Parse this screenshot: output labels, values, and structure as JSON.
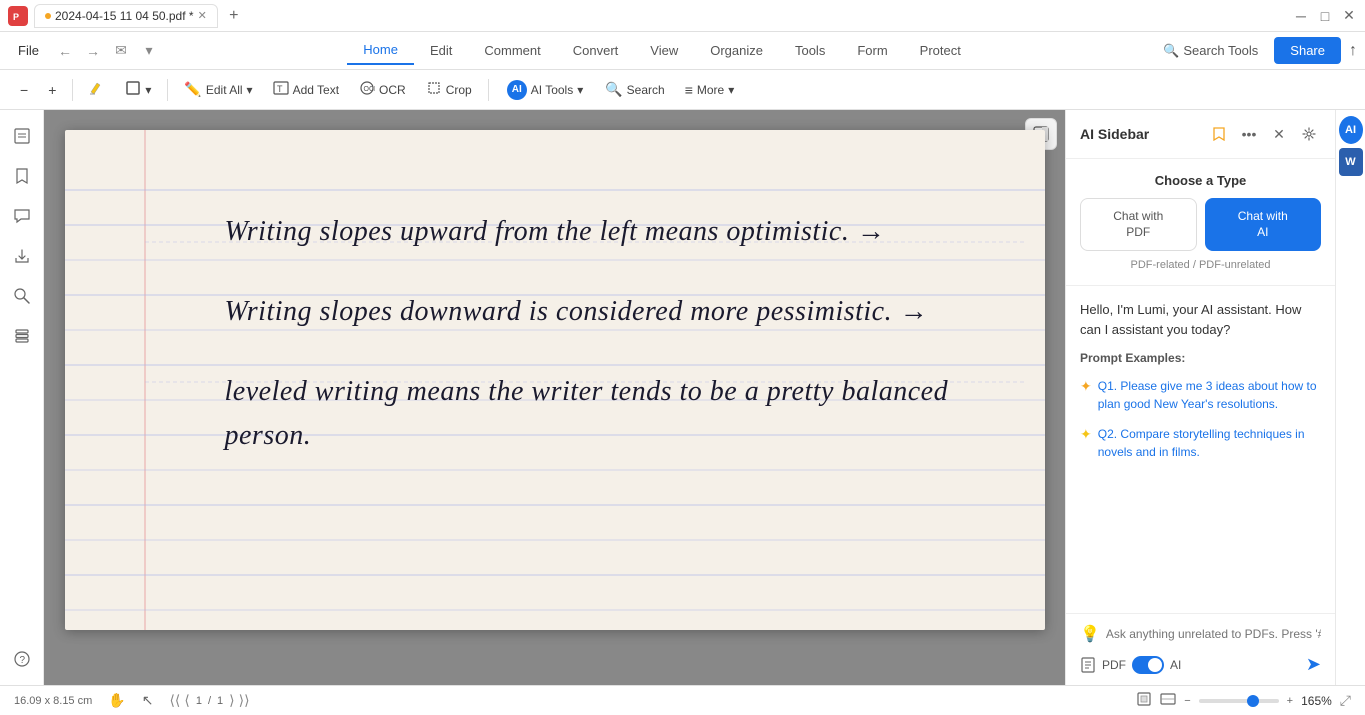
{
  "titlebar": {
    "app_icon": "P",
    "tab_name": "2024-04-15 11 04 50.pdf *",
    "add_tab": "+",
    "window_controls": [
      "─",
      "□",
      "✕"
    ]
  },
  "menubar": {
    "file_label": "File",
    "nav_back": "←",
    "nav_forward": "→",
    "nav_email": "✉",
    "nav_menu": "▾",
    "tabs": [
      {
        "label": "Home",
        "active": true
      },
      {
        "label": "Edit",
        "active": false
      },
      {
        "label": "Comment",
        "active": false
      },
      {
        "label": "Convert",
        "active": false
      },
      {
        "label": "View",
        "active": false
      },
      {
        "label": "Organize",
        "active": false
      },
      {
        "label": "Tools",
        "active": false
      },
      {
        "label": "Form",
        "active": false
      },
      {
        "label": "Protect",
        "active": false
      }
    ],
    "search_tools_label": "Search Tools",
    "share_label": "Share",
    "upload_icon": "↑"
  },
  "toolbar": {
    "zoom_out": "−",
    "zoom_in": "+",
    "highlight": "✎",
    "shapes": "□",
    "edit_all": "Edit All",
    "add_text": "Add Text",
    "ocr": "OCR",
    "crop": "Crop",
    "ai_tools": "AI Tools",
    "search": "Search",
    "more": "More"
  },
  "left_panel": {
    "icons": [
      "☰",
      "🔖",
      "💬",
      "🔗",
      "🔍",
      "⊞",
      "?"
    ]
  },
  "pdf": {
    "line1": "Writing slopes upward from the left means optimistic. →",
    "line2": "Writing slopes downward is considered more pessimistic. →",
    "line3": "leveled writing means the writer tends to be a pretty balanced person."
  },
  "ai_sidebar": {
    "title": "AI Sidebar",
    "actions": {
      "bookmark": "🔖",
      "more": "•••",
      "close": "✕",
      "settings": "⚙"
    },
    "choose_type": {
      "title": "Choose a Type",
      "btn_pdf_label1": "Chat with",
      "btn_pdf_label2": "PDF",
      "btn_ai_label1": "Chat with",
      "btn_ai_label2": "AI",
      "note": "PDF-related / PDF-unrelated"
    },
    "greeting": "Hello, I'm Lumi, your AI assistant. How can I assistant you today?",
    "prompt_examples_title": "Prompt Examples:",
    "prompts": [
      {
        "star": "✦",
        "text": "Q1. Please give me 3 ideas about how to plan good New Year's resolutions."
      },
      {
        "star": "✦",
        "text": "Q2. Compare storytelling techniques in novels and in films."
      }
    ],
    "input_placeholder": "Ask anything unrelated to PDFs. Press '#' for Prompts.",
    "input_icon": "💡",
    "toggle_pdf_label": "PDF",
    "toggle_ai_label": "AI",
    "send_icon": "➤"
  },
  "right_edge": {
    "ai_label": "AI",
    "word_label": "W"
  },
  "statusbar": {
    "dimensions": "16.09 x 8.15 cm",
    "hand_icon": "✋",
    "cursor_icon": "↖",
    "page_first": "⟨⟨",
    "page_prev": "⟨",
    "page_current": "1",
    "page_separator": "/",
    "page_total": "1",
    "page_next": "⟩",
    "page_last": "⟩⟩",
    "fit_page": "⊡",
    "fit_width": "⊟",
    "zoom_out": "−",
    "zoom_percent": "165%",
    "zoom_in": "+",
    "fullscreen": "⤢"
  }
}
